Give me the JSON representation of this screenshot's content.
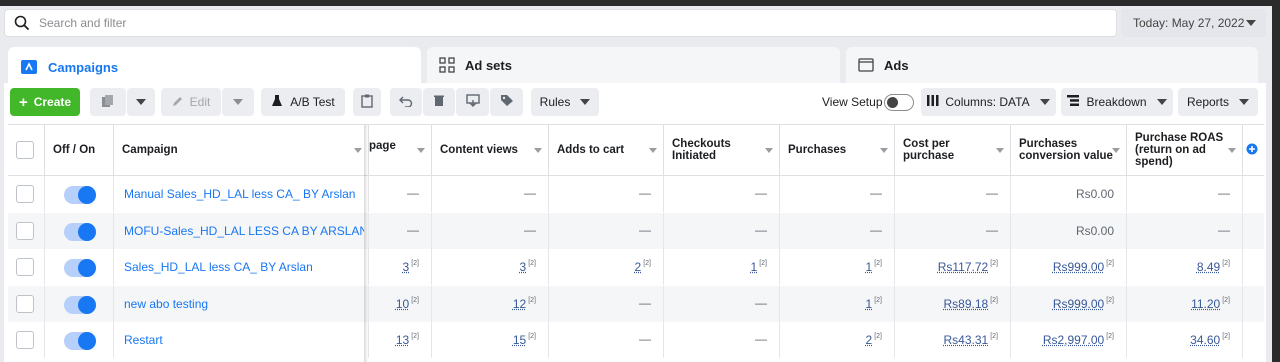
{
  "search": {
    "placeholder": "Search and filter"
  },
  "date": {
    "label": "Today: May 27, 2022"
  },
  "tabs": [
    {
      "label": "Campaigns",
      "icon": "campaign-icon"
    },
    {
      "label": "Ad sets",
      "icon": "grid-icon"
    },
    {
      "label": "Ads",
      "icon": "ad-icon"
    }
  ],
  "toolbar": {
    "create": "Create",
    "edit": "Edit",
    "ab_test": "A/B Test",
    "rules": "Rules",
    "view_setup": "View Setup",
    "columns": "Columns: DATA",
    "breakdown": "Breakdown",
    "reports": "Reports"
  },
  "table": {
    "headers": {
      "onoff": "Off / On",
      "campaign": "Campaign",
      "page": "page",
      "content_views": "Content views",
      "adds_to_cart": "Adds to cart",
      "checkouts_1": "Checkouts",
      "checkouts_2": "Initiated",
      "purchases": "Purchases",
      "cpp_1": "Cost per",
      "cpp_2": "purchase",
      "pcv_1": "Purchases",
      "pcv_2": "conversion value",
      "roas_1": "Purchase ROAS",
      "roas_2": "(return on ad",
      "roas_3": "spend)"
    },
    "rows": [
      {
        "name": "Manual Sales_HD_LAL less CA_ BY Arslan",
        "page": "—",
        "content_views": "—",
        "adds_to_cart": "—",
        "checkouts": "—",
        "purchases": "—",
        "cpp": "—",
        "pcv": "Rs0.00",
        "roas": "—"
      },
      {
        "name": "MOFU-Sales_HD_LAL LESS CA BY ARSLAN S...",
        "page": "—",
        "content_views": "—",
        "adds_to_cart": "—",
        "checkouts": "—",
        "purchases": "—",
        "cpp": "—",
        "pcv": "Rs0.00",
        "roas": "—"
      },
      {
        "name": "Sales_HD_LAL less CA_ BY Arslan",
        "page": "3",
        "content_views": "3",
        "adds_to_cart": "2",
        "checkouts": "1",
        "purchases": "1",
        "cpp": "Rs117.72",
        "pcv": "Rs999.00",
        "roas": "8.49"
      },
      {
        "name": "new abo testing",
        "page": "10",
        "content_views": "12",
        "adds_to_cart": "—",
        "checkouts": "—",
        "purchases": "1",
        "cpp": "Rs89.18",
        "pcv": "Rs999.00",
        "roas": "11.20"
      },
      {
        "name": "Restart",
        "page": "13",
        "content_views": "15",
        "adds_to_cart": "—",
        "checkouts": "—",
        "purchases": "2",
        "cpp": "Rs43.31",
        "pcv": "Rs2,997.00",
        "roas": "34.60"
      }
    ],
    "footnote_mark": "[2]"
  },
  "colors": {
    "accent": "#1877f2",
    "create": "#42b72a"
  }
}
